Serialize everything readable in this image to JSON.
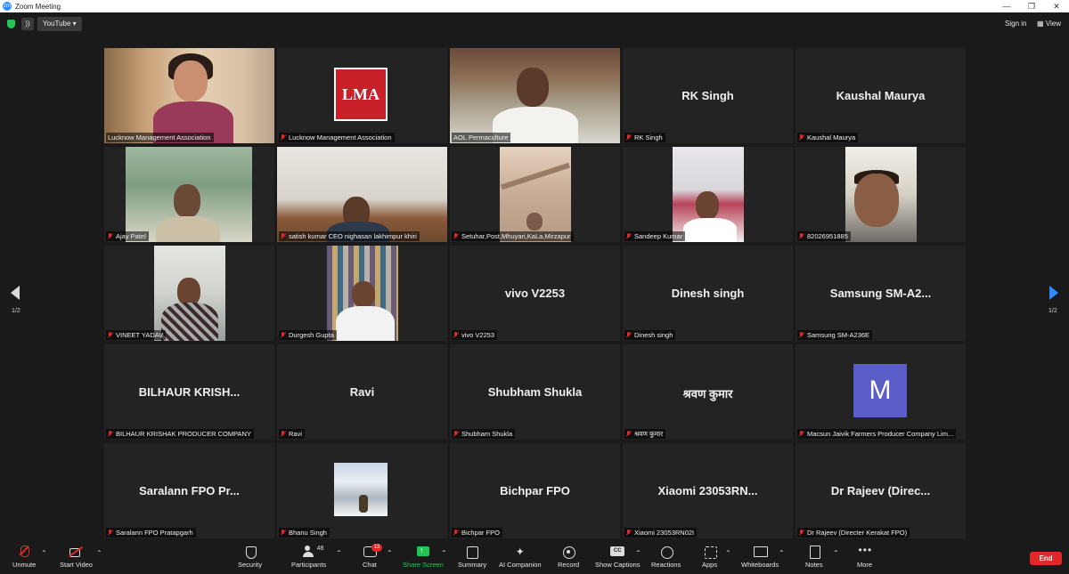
{
  "window": {
    "title": "Zoom Meeting",
    "logo_text": "zm",
    "controls": [
      "—",
      "❐",
      "✕"
    ]
  },
  "top": {
    "rss_icon": "rss",
    "youtube_label": "YouTube ▾",
    "signin_label": "Sign in",
    "view_label": "View",
    "view_icon": "grid-icon"
  },
  "pagination": {
    "left": "1/2",
    "right": "1/2"
  },
  "tiles": [
    {
      "label": "Lucknow Management Association",
      "muted": false,
      "kind": "video-woman"
    },
    {
      "label": "Lucknow Management Association",
      "muted": true,
      "kind": "logo",
      "logo_text": "LMA"
    },
    {
      "label": "AOL Permaculture",
      "muted": false,
      "kind": "video-aol",
      "active": true
    },
    {
      "label": "RK Singh",
      "muted": true,
      "kind": "name",
      "display_name": "RK Singh"
    },
    {
      "label": "Kaushal Maurya",
      "muted": true,
      "kind": "name",
      "display_name": "Kaushal Maurya"
    },
    {
      "label": "Ajay Patel",
      "muted": true,
      "kind": "video-green"
    },
    {
      "label": "satish kumar CEO nighasan lakhimpur khiri",
      "muted": true,
      "kind": "video-office"
    },
    {
      "label": "Setuhar,Post,Mhuyari,KaLa,Mirzapur",
      "muted": true,
      "kind": "video-ceiling"
    },
    {
      "label": "Sandeep Kumar",
      "muted": true,
      "kind": "video-bed"
    },
    {
      "label": "82026951885",
      "muted": true,
      "kind": "video-close"
    },
    {
      "label": "VINEET YADAV",
      "muted": true,
      "kind": "video-vineet"
    },
    {
      "label": "Durgesh Gupta",
      "muted": true,
      "kind": "video-shop"
    },
    {
      "label": "vivo V2253",
      "muted": true,
      "kind": "name",
      "display_name": "vivo V2253"
    },
    {
      "label": "Dinesh singh",
      "muted": true,
      "kind": "name",
      "display_name": "Dinesh singh"
    },
    {
      "label": "Samsung SM-A236E",
      "muted": true,
      "kind": "name",
      "display_name": "Samsung  SM-A2..."
    },
    {
      "label": "BILHAUR KRISHAK PRODUCER COMPANY",
      "muted": true,
      "kind": "name",
      "display_name": "BILHAUR  KRISH..."
    },
    {
      "label": "Ravi",
      "muted": true,
      "kind": "name",
      "display_name": "Ravi"
    },
    {
      "label": "Shubham Shukla",
      "muted": true,
      "kind": "name",
      "display_name": "Shubham Shukla"
    },
    {
      "label": "श्रवण कुमार",
      "muted": true,
      "kind": "name",
      "display_name": "श्रवण कुमार"
    },
    {
      "label": "Macsun Jaivik Farmers Producer Company Lim...",
      "muted": true,
      "kind": "avatar",
      "avatar_letter": "M",
      "avatar_color": "#5b5ec9"
    },
    {
      "label": "Saralann FPO Pratapgarh",
      "muted": true,
      "kind": "name",
      "display_name": "Saralann FPO Pr..."
    },
    {
      "label": "Bhanu Singh",
      "muted": true,
      "kind": "video-snow"
    },
    {
      "label": "Bichpar FPO",
      "muted": true,
      "kind": "name",
      "display_name": "Bichpar FPO"
    },
    {
      "label": "Xiaomi 23053RN02I",
      "muted": true,
      "kind": "name",
      "display_name": "Xiaomi  23053RN..."
    },
    {
      "label": "Dr Rajeev (Directer Kerakat FPO)",
      "muted": true,
      "kind": "name",
      "display_name": "Dr Rajeev  (Direc..."
    }
  ],
  "toolbar": {
    "unmute": "Unmute",
    "start_video": "Start Video",
    "security": "Security",
    "participants": "Participants",
    "participants_count": "48",
    "chat": "Chat",
    "chat_badge": "13",
    "share_screen": "Share Screen",
    "summary": "Summary",
    "ai_companion": "AI Companion",
    "record": "Record",
    "show_captions": "Show Captions",
    "reactions": "Reactions",
    "apps": "Apps",
    "whiteboards": "Whiteboards",
    "notes": "Notes",
    "more": "More",
    "end": "End"
  },
  "colors": {
    "accent": "#2d8cff",
    "active_speaker": "#b4e36d",
    "end": "#e02828",
    "share": "#23c552",
    "muted_mic": "#e02828"
  }
}
